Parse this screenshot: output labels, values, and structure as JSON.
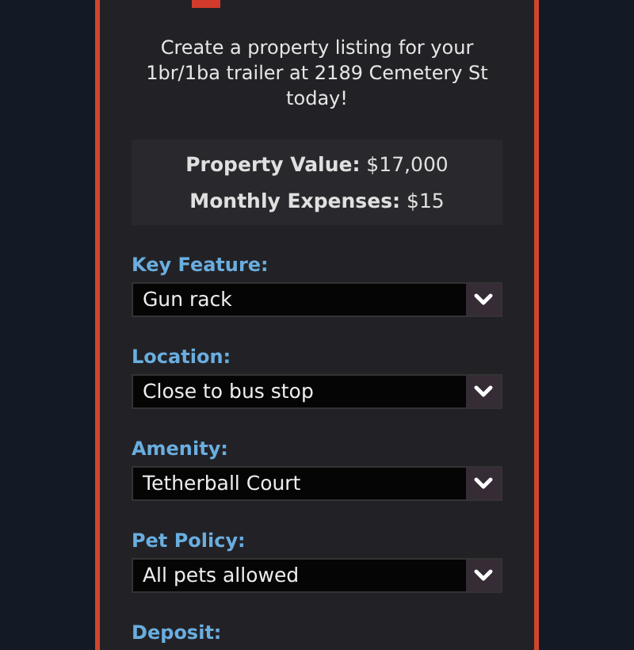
{
  "dialog": {
    "description": "Create a property listing for your 1br/1ba trailer at 2189 Cemetery St today!",
    "stats": [
      {
        "label": "Property Value:",
        "value": "$17,000"
      },
      {
        "label": "Monthly Expenses:",
        "value": "$15"
      }
    ],
    "fields": [
      {
        "label": "Key Feature:",
        "value": "Gun rack"
      },
      {
        "label": "Location:",
        "value": "Close to bus stop"
      },
      {
        "label": "Amenity:",
        "value": "Tetherball Court"
      },
      {
        "label": "Pet Policy:",
        "value": "All pets allowed"
      },
      {
        "label": "Deposit:"
      }
    ]
  }
}
